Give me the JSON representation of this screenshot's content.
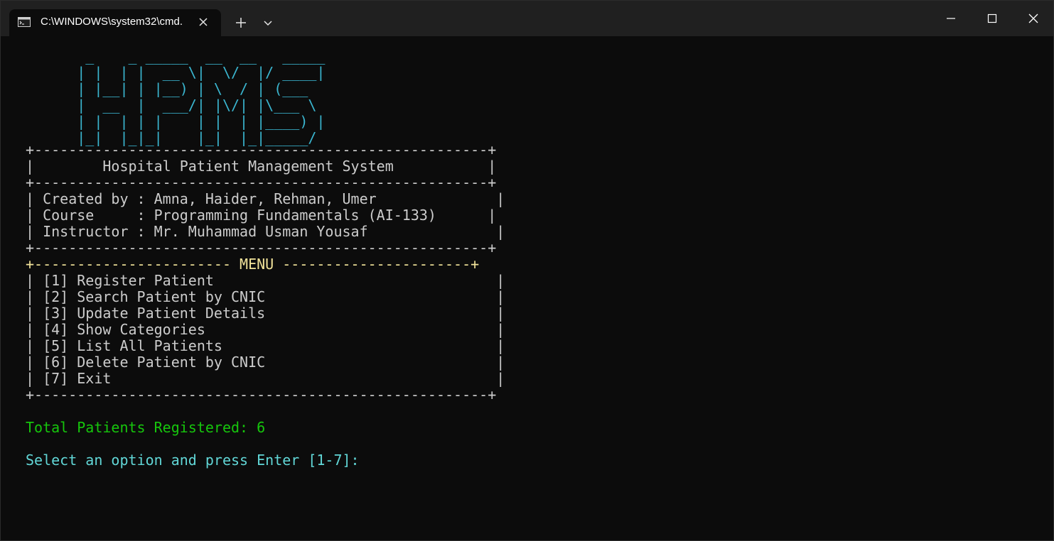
{
  "window": {
    "tab_title": "C:\\WINDOWS\\system32\\cmd.",
    "icons": {
      "tab": "terminal-icon",
      "tab_close": "close-icon",
      "new_tab": "plus-icon",
      "dropdown": "chevron-down-icon",
      "minimize": "minimize-icon",
      "maximize": "maximize-icon",
      "close": "close-icon"
    }
  },
  "terminal": {
    "logo_lines": [
      "       _    _ _____  __  __   _____",
      "      | |  | |  __ \\|  \\/  |/ ____|",
      "      | |__| | |__) | \\  / | (___",
      "      |  __  |  ___/| |\\/| |\\___ \\",
      "      | |  | | |    | |  | |____) |",
      "      |_|  |_|_|    |_|  |_|_____/"
    ],
    "border_top": "+-----------------------------------------------------+",
    "system_title_line": "|        Hospital Patient Management System           |",
    "border_mid": "+-----------------------------------------------------+",
    "info_lines": [
      "| Created by : Amna, Haider, Rehman, Umer              |",
      "| Course     : Programming Fundamentals (AI-133)      |",
      "| Instructor : Mr. Muhammad Usman Yousaf               |"
    ],
    "border_info_bottom": "+-----------------------------------------------------+",
    "menu_header": "+----------------------- MENU ----------------------+",
    "menu_items": [
      "| [1] Register Patient                                 |",
      "| [2] Search Patient by CNIC                           |",
      "| [3] Update Patient Details                           |",
      "| [4] Show Categories                                  |",
      "| [5] List All Patients                                |",
      "| [6] Delete Patient by CNIC                           |",
      "| [7] Exit                                             |"
    ],
    "border_bottom": "+-----------------------------------------------------+",
    "total_patients": "Total Patients Registered: 6",
    "prompt": "Select an option and press Enter [1-7]:"
  },
  "colors": {
    "background": "#0c0c0c",
    "titlebar": "#202020",
    "logo": "#3ab6d0",
    "menu_header": "#f2e39a",
    "total": "#16c60c",
    "prompt": "#61d6d6",
    "text": "#cccccc"
  }
}
